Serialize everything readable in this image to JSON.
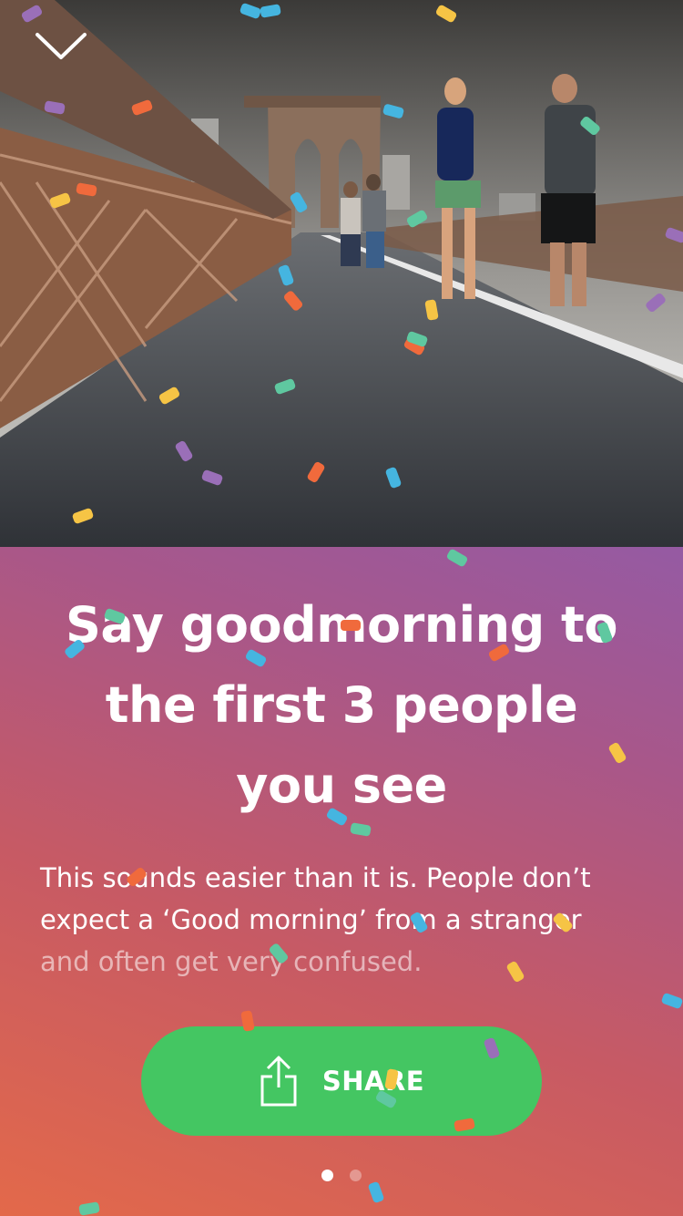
{
  "header": {
    "collapse_icon": "chevron-down-icon"
  },
  "photo": {
    "description_icon": "runners-on-bridge-photo"
  },
  "card": {
    "title_lines": [
      "Say goodmorning to",
      "the first 3 people",
      "you see"
    ],
    "body_lines": [
      "This sounds easier than it is. People don’t",
      "expect a ‘Good morning’ from a stranger",
      "and often get very confused."
    ],
    "share": {
      "label": "SHARE",
      "icon": "share-icon"
    },
    "pagination": {
      "current": 1,
      "total": 2
    }
  },
  "colors": {
    "gradient_start": "#e3694a",
    "gradient_end": "#955aa3",
    "share_green": "#44c662",
    "confetti": [
      "#f6c445",
      "#5fc8a0",
      "#45b5e0",
      "#f06a3c",
      "#9a6fb8"
    ]
  }
}
